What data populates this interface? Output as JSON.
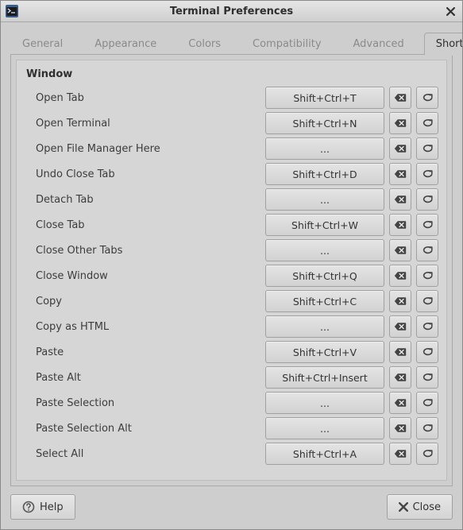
{
  "window": {
    "title": "Terminal Preferences"
  },
  "tabs": [
    {
      "label": "General"
    },
    {
      "label": "Appearance"
    },
    {
      "label": "Colors"
    },
    {
      "label": "Compatibility"
    },
    {
      "label": "Advanced"
    },
    {
      "label": "Shortcuts"
    }
  ],
  "section": {
    "title": "Window"
  },
  "shortcuts": [
    {
      "label": "Open Tab",
      "accel": "Shift+Ctrl+T"
    },
    {
      "label": "Open Terminal",
      "accel": "Shift+Ctrl+N"
    },
    {
      "label": "Open File Manager Here",
      "accel": "..."
    },
    {
      "label": "Undo Close Tab",
      "accel": "Shift+Ctrl+D"
    },
    {
      "label": "Detach Tab",
      "accel": "..."
    },
    {
      "label": "Close Tab",
      "accel": "Shift+Ctrl+W"
    },
    {
      "label": "Close Other Tabs",
      "accel": "..."
    },
    {
      "label": "Close Window",
      "accel": "Shift+Ctrl+Q"
    },
    {
      "label": "Copy",
      "accel": "Shift+Ctrl+C"
    },
    {
      "label": "Copy as HTML",
      "accel": "..."
    },
    {
      "label": "Paste",
      "accel": "Shift+Ctrl+V"
    },
    {
      "label": "Paste Alt",
      "accel": "Shift+Ctrl+Insert"
    },
    {
      "label": "Paste Selection",
      "accel": "..."
    },
    {
      "label": "Paste Selection Alt",
      "accel": "..."
    },
    {
      "label": "Select All",
      "accel": "Shift+Ctrl+A"
    }
  ],
  "footer": {
    "help_label": "Help",
    "close_label": "Close"
  }
}
